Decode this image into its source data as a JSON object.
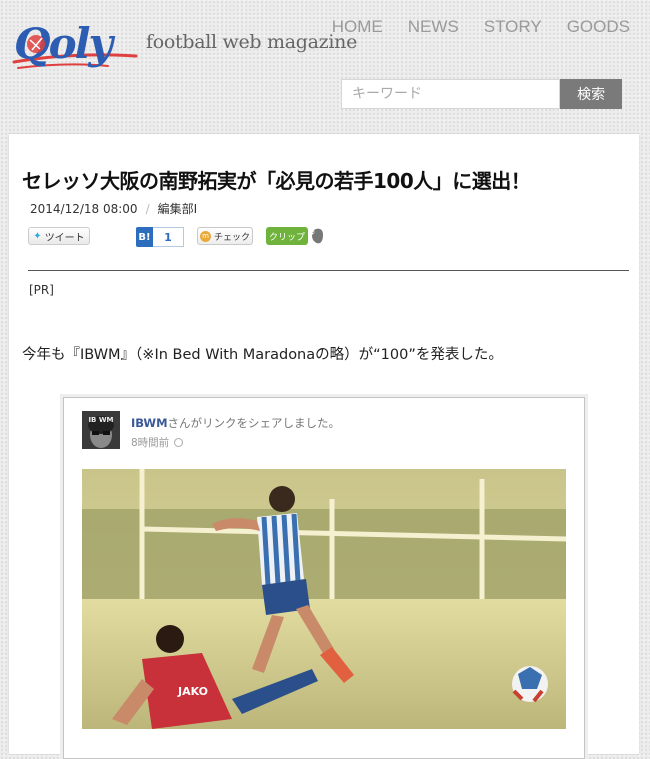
{
  "site": {
    "logo_text": "Qoly",
    "tagline": "football web magazine",
    "nav": [
      "HOME",
      "NEWS",
      "STORY",
      "GOODS"
    ],
    "search": {
      "placeholder": "キーワード",
      "button": "検索"
    }
  },
  "article": {
    "title": "セレッソ大阪の南野拓実が「必見の若手100人」に選出！",
    "date": "2014/12/18 08:00",
    "separator": "/",
    "author": "編集部I",
    "social": {
      "tweet": "ツイート",
      "hatena_mark": "B!",
      "hatena_count": "1",
      "check_mark": "m",
      "check": "チェック",
      "clip": "クリップ"
    },
    "pr": "[PR]",
    "body": "今年も『IBWM』（※In Bed With Maradonaの略）が“100”を発表した。"
  },
  "embed": {
    "page_name": "IBWM",
    "share_text": "さんがリンクをシェアしました。",
    "time": "8時間前",
    "avatar_text": "IB WM",
    "jersey_text": "JAKO"
  },
  "colors": {
    "logo_blue": "#2d5db3",
    "logo_red": "#e04040",
    "search_button": "#7a7a7a",
    "hatena_blue": "#2c6ebd",
    "clip_green": "#6fb33c",
    "fb_name": "#3b5998"
  }
}
